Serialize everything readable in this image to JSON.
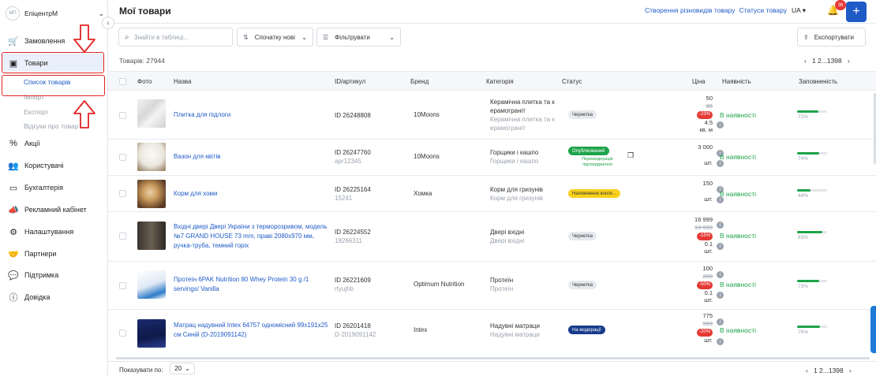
{
  "sidebar": {
    "brand": "ЕпіцентрМ",
    "logo_text": "МП",
    "items": [
      {
        "label": "Замовлення",
        "icon": "cart-icon"
      },
      {
        "label": "Товари",
        "icon": "box-icon"
      },
      {
        "label": "Акції",
        "icon": "percent-icon"
      },
      {
        "label": "Користувачі",
        "icon": "users-icon"
      },
      {
        "label": "Бухгалтерія",
        "icon": "wallet-icon"
      },
      {
        "label": "Рекламний кабінет",
        "icon": "megaphone-icon"
      },
      {
        "label": "Налаштування",
        "icon": "gear-icon"
      },
      {
        "label": "Партнери",
        "icon": "handshake-icon"
      },
      {
        "label": "Підтримка",
        "icon": "chat-icon"
      },
      {
        "label": "Довідка",
        "icon": "question-icon"
      }
    ],
    "sub_items": [
      "Список товарів",
      "Імпорт",
      "Експорт",
      "Відгуки про товар"
    ]
  },
  "header": {
    "title": "Мої товари",
    "link_variants": "Створення різновидів товару",
    "link_statuses": "Статуси товару",
    "lang": "UA",
    "notif_count": "36",
    "plus": "+"
  },
  "toolbar": {
    "search_placeholder": "Знайти в таблиці...",
    "sort_label": "Спочатку нові",
    "filter_label": "Фільтрувати",
    "export_label": "Експортувати"
  },
  "table": {
    "total": "Товарів: 27944",
    "pages_top": "1  2...1398",
    "columns": [
      "Фото",
      "Назва",
      "ID/артикул",
      "Бренд",
      "Категорія",
      "Статус",
      "Ціна",
      "Наявність",
      "Заповненість"
    ],
    "rows": [
      {
        "name": "Плитка для підлоги",
        "id": "ID 26248808",
        "sku": "",
        "brand": "10Moons",
        "cat": "Керамічна плитка та к ерамограніт",
        "cat2": "Керамічна плитка та к ерамограніт",
        "status": "Чернетка",
        "status_type": "draft",
        "price": "50",
        "old_price": "65",
        "discount": "-23%",
        "qty": "4.5",
        "unit": "кв. м",
        "avail": "В наявності",
        "fill": 72,
        "fill_label": "72%"
      },
      {
        "name": "Вазон для квітів",
        "id": "ID 26247760",
        "sku": "apr12345",
        "brand": "10Moons",
        "cat": "Горщики і кашпо",
        "cat2": "Горщики і кашпо",
        "status": "Опублікований",
        "status_type": "pub",
        "status_note": "Перемодерація підтвердження",
        "price": "3 000",
        "old_price": "",
        "discount": "",
        "qty": "",
        "unit": "шт.",
        "avail": "В наявності",
        "fill": 74,
        "fill_label": "74%"
      },
      {
        "name": "Корм для хоми",
        "id": "ID 26225164",
        "sku": "15241",
        "brand": "Хомка",
        "cat": "Корм для гризунів",
        "cat2": "Корм для гризунів",
        "status": "Наповнення конте...",
        "status_type": "fill",
        "price": "150",
        "old_price": "",
        "discount": "",
        "qty": "",
        "unit": "шт.",
        "avail": "В наявності",
        "fill": 44,
        "fill_label": "44%"
      },
      {
        "name": "Вхідні двері Двері України з терморозривом, модель №7 GRAND HOUSE 73 mm, праві 2080x970 мм, ручка-труба, темний горіх",
        "id": "ID 26224552",
        "sku": "18266311",
        "brand": "",
        "cat": "Двері вхідні",
        "cat2": "Двері вхідні",
        "status": "Чернетка",
        "status_type": "draft",
        "price": "16 999",
        "old_price": "19 999",
        "discount": "-15%",
        "qty": "0.1",
        "unit": "шт.",
        "avail": "В наявності",
        "fill": 83,
        "fill_label": "83%"
      },
      {
        "name": "Протеїн 6PAK Nutrition 80 Whey Protein 30 g /1 servings/ Vanilla",
        "id": "ID 26221609",
        "sku": "rtyujhb",
        "brand": "Optimum Nutrition",
        "cat": "Протеїн",
        "cat2": "Протеїн",
        "status": "Чернетка",
        "status_type": "draft",
        "price": "100",
        "old_price": "200",
        "discount": "-50%",
        "qty": "0.1",
        "unit": "шт.",
        "avail": "В наявності",
        "fill": 73,
        "fill_label": "73%"
      },
      {
        "name": "Матрац надувний Intex 64757 одномісний 99x191x25 см Синій (D-2019091142)",
        "id": "ID 26201418",
        "sku": "D-2019091142",
        "brand": "Intex",
        "cat": "Надувні матраци",
        "cat2": "Надувні матраци",
        "status": "На модерації",
        "status_type": "mod",
        "price": "775",
        "old_price": "969",
        "discount": "-20%",
        "qty": "",
        "unit": "шт.",
        "avail": "В наявності",
        "fill": 76,
        "fill_label": "76%"
      }
    ]
  },
  "footer": {
    "show_label": "Показувати по:",
    "page_size": "20",
    "pages_bottom": "1  2...1398"
  }
}
